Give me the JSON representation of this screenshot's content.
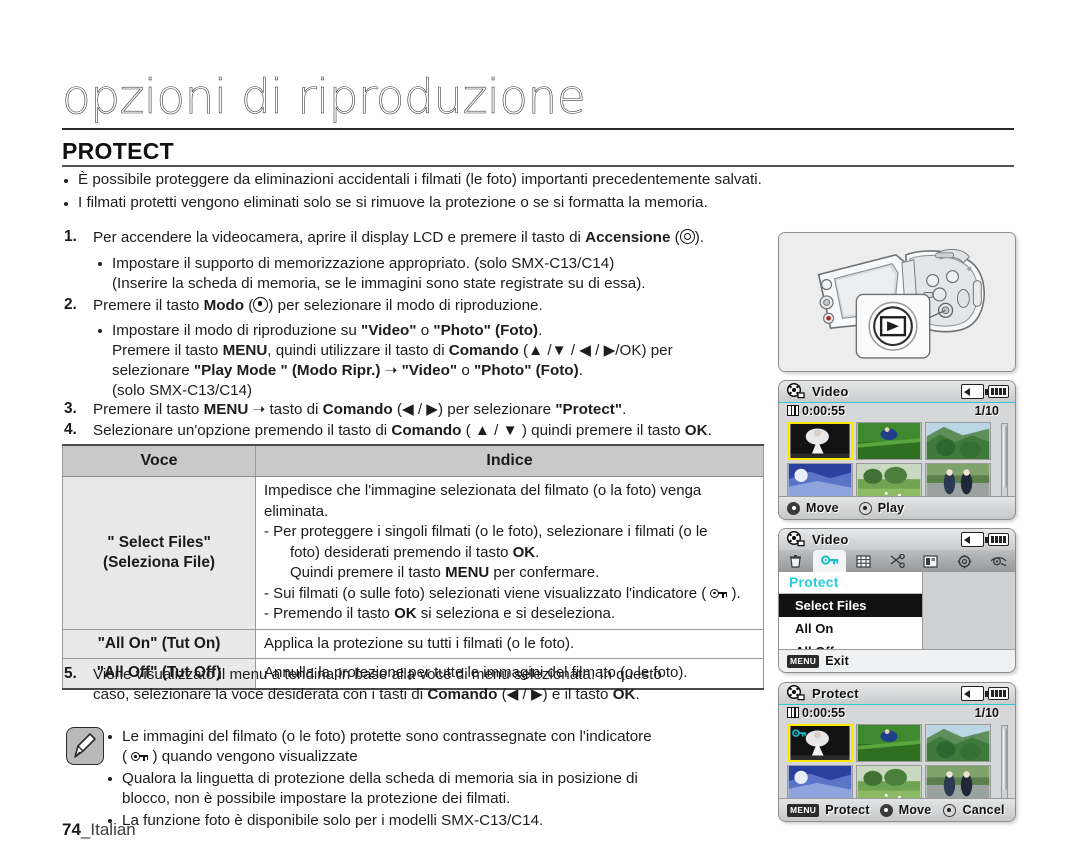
{
  "header": {
    "chapter_title": "opzioni di riproduzione",
    "section_title": "PROTECT"
  },
  "intro_bullets": [
    "È possibile proteggere da eliminazioni accidentali i filmati (le foto) importanti precedentemente salvati.",
    "I filmati protetti vengono eliminati solo se si rimuove la protezione o se si formatta la memoria."
  ],
  "steps": {
    "s1_num": "1.",
    "s1_a": "Per accendere la videocamera, aprire il display LCD e premere il tasto di ",
    "s1_b": "Accensione",
    "s1_c": " (",
    "s1_d": ").",
    "s1_sub1": "Impostare il supporto di memorizzazione appropriato. (solo SMX-C13/C14)",
    "s1_sub2": "(Inserire la scheda di memoria, se le immagini sono state registrate su di essa).",
    "s2_num": "2.",
    "s2_a": "Premere il tasto ",
    "s2_b": "Modo",
    "s2_c": " (",
    "s2_d": ") per selezionare il modo di riproduzione.",
    "s2_sub1_a": "Impostare il modo di riproduzione su ",
    "s2_sub1_b": "\"Video\"",
    "s2_sub1_c": " o ",
    "s2_sub1_d": "\"Photo\" (Foto)",
    "s2_sub1_e": ".",
    "s2_sub2_a": "Premere il tasto ",
    "s2_sub2_b": "MENU",
    "s2_sub2_c": ", quindi utilizzare il tasto di ",
    "s2_sub2_d": "Comando",
    "s2_sub2_e": " (▲ /▼ / ◀ / ▶/OK) per",
    "s2_sub3_a": "selezionare ",
    "s2_sub3_b": "\"Play Mode \" (Modo Ripr.)",
    "s2_sub3_c": " ➝ ",
    "s2_sub3_d": "\"Video\"",
    "s2_sub3_e": " o ",
    "s2_sub3_f": "\"Photo\" (Foto)",
    "s2_sub3_g": ".",
    "s2_sub4": "(solo SMX-C13/C14)",
    "s3_num": "3.",
    "s3_a": "Premere il tasto ",
    "s3_b": "MENU",
    "s3_c": " ➝ tasto di ",
    "s3_d": "Comando",
    "s3_e": " (◀ / ▶) per selezionare  ",
    "s3_f": "\"Protect\"",
    "s3_g": ".",
    "s4_num": "4.",
    "s4_a": "Selezionare un'opzione premendo il tasto di ",
    "s4_b": "Comando",
    "s4_c": " ( ▲ / ▼ ) quindi premere il tasto ",
    "s4_d": "OK",
    "s4_e": ".",
    "s5_num": "5.",
    "s5_a": "Viene visualizzato il menu a tendina in base alla voce di menu selezionata. In questo",
    "s5_b": "caso, selezionare la voce desiderata con i tasti di ",
    "s5_c": "Comando",
    "s5_d": " (◀ / ▶) e il tasto ",
    "s5_e": "OK",
    "s5_f": "."
  },
  "table": {
    "headers": [
      "Voce",
      "Indice"
    ],
    "rows": [
      {
        "item_line1": "\" Select Files\"",
        "item_line2": "(Seleziona File)",
        "desc": {
          "l1": "Impedisce che l'immagine selezionata del filmato (o la foto) venga",
          "l2": "eliminata.",
          "l3": "- Per proteggere i singoli filmati (o le foto), selezionare i filmati (o le",
          "l4_a": "foto) desiderati premendo il tasto ",
          "l4_b": "OK",
          "l4_c": ".",
          "l5_a": "Quindi premere il tasto ",
          "l5_b": "MENU",
          "l5_c": " per confermare.",
          "l6_a": "- Sui filmati (o sulle foto) selezionati viene visualizzato l'indicatore ( ",
          "l6_b": " ).",
          "l7_a": "-  Premendo il tasto ",
          "l7_b": "OK",
          "l7_c": " si seleziona e si deseleziona."
        }
      },
      {
        "item_line1": "\"All On\" (Tut On)",
        "desc_simple": "Applica la protezione su tutti i filmati (o le foto)."
      },
      {
        "item_line1": "\"All Off\" (Tut Off)",
        "desc_simple": "Annulla la protezione per tutte le immagini del filmato (o le foto)."
      }
    ]
  },
  "notes": [
    {
      "l1": "Le immagini del filmato (o le foto) protette sono contrassegnate con l'indicatore",
      "l2_a": "( ",
      "l2_b": " ) quando vengono visualizzate"
    },
    {
      "l1": "Qualora la linguetta di protezione della scheda di memoria sia in posizione di",
      "l2": "blocco, non è possibile impostare la protezione dei filmati."
    },
    {
      "l1": "La funzione foto è disponibile solo per i modelli SMX-C13/C14."
    }
  ],
  "footer": {
    "page": "74",
    "sep": "_",
    "lang": "Italian"
  },
  "figures": {
    "camcorder": {
      "caption_icon": "playback-mode-icon"
    },
    "lcd1": {
      "title": "Video",
      "timecode": "0:00:55",
      "counter": "1/10",
      "hint_move": "Move",
      "hint_play": "Play"
    },
    "lcd2": {
      "title": "Video",
      "menu_header": "Protect",
      "items": [
        "Select Files",
        "All On",
        "All Off"
      ],
      "selected_index": 0,
      "menu_chip": "MENU",
      "exit_label": "Exit",
      "tabs": [
        "delete-icon",
        "protect-key-icon",
        "grid-icon",
        "scissors-icon",
        "book-icon",
        "gear-icon",
        "eye-icon"
      ],
      "active_tab_index": 1
    },
    "lcd3": {
      "title": "Protect",
      "timecode": "0:00:55",
      "counter": "1/10",
      "menu_chip": "MENU",
      "hint_protect": "Protect",
      "hint_move": "Move",
      "hint_cancel": "Cancel"
    }
  },
  "colors": {
    "accent_cyan": "#22cfe0",
    "selection_yellow": "#ffe800",
    "table_header_gray": "#c9c9c9",
    "table_cell_gray": "#e9e9e9"
  }
}
